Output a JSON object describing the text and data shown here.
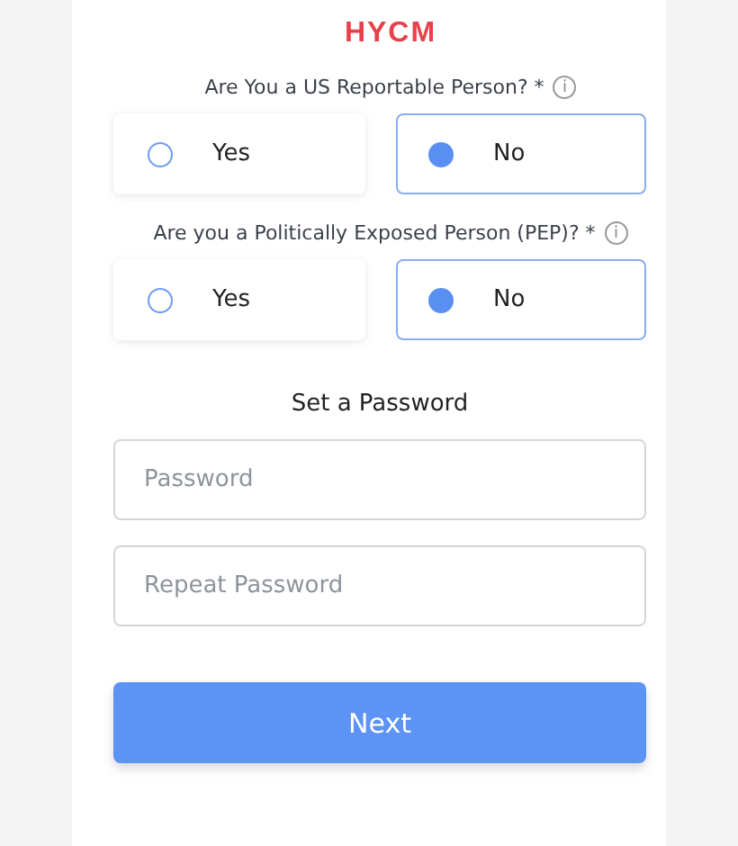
{
  "logo": {
    "text": "HYCM"
  },
  "questions": [
    {
      "label": "Are You a US Reportable Person? *",
      "info": "i",
      "options": [
        {
          "label": "Yes",
          "selected": false
        },
        {
          "label": "No",
          "selected": true
        }
      ]
    },
    {
      "label": "Are you a Politically Exposed Person (PEP)? *",
      "info": "i",
      "options": [
        {
          "label": "Yes",
          "selected": false
        },
        {
          "label": "No",
          "selected": true
        }
      ]
    }
  ],
  "password_section": {
    "title": "Set a Password",
    "fields": [
      {
        "placeholder": "Password"
      },
      {
        "placeholder": "Repeat Password"
      }
    ]
  },
  "next_button": {
    "label": "Next"
  }
}
